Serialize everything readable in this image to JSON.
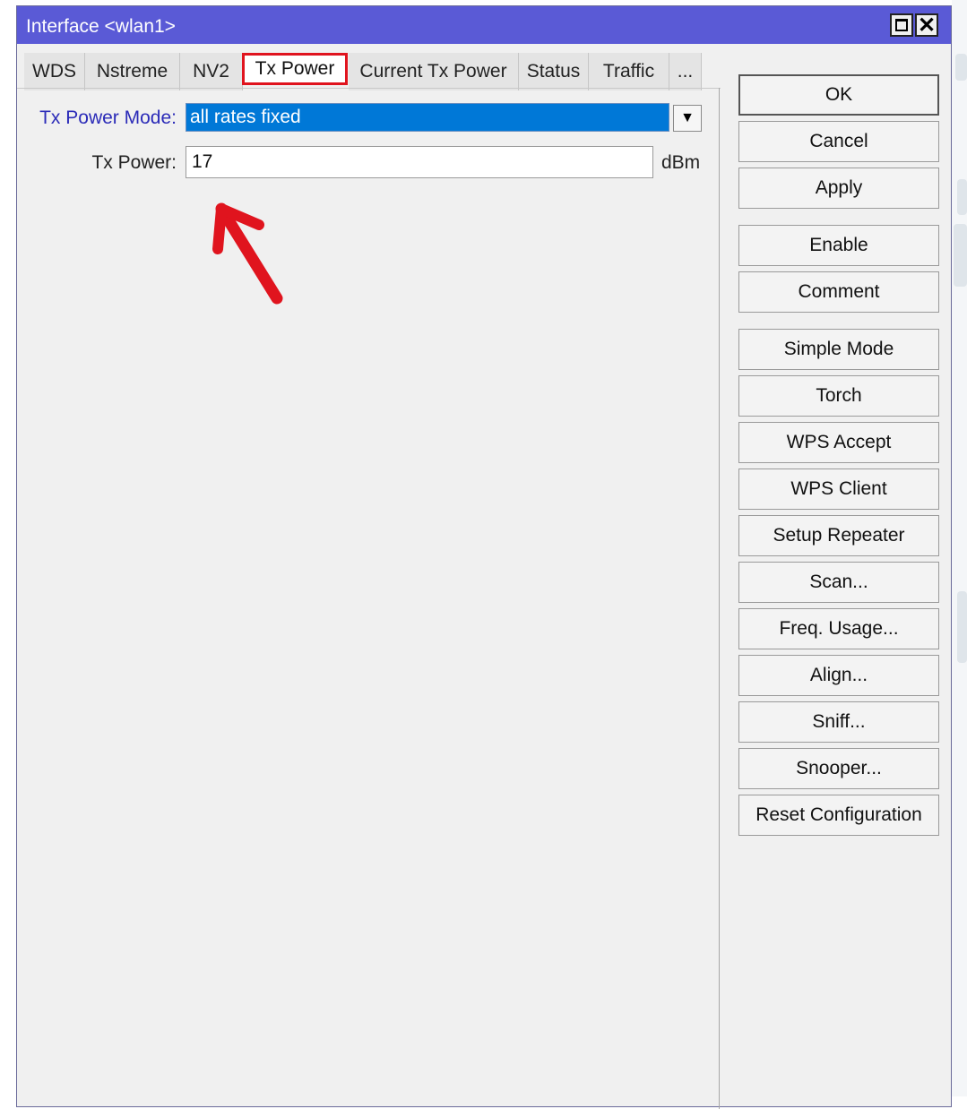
{
  "window": {
    "title": "Interface <wlan1>",
    "maximize_glyph": "",
    "close_glyph": "✕"
  },
  "tabs": [
    {
      "label": "WDS"
    },
    {
      "label": "Nstreme"
    },
    {
      "label": "NV2"
    },
    {
      "label": "Tx Power",
      "active": true
    },
    {
      "label": "Current Tx Power"
    },
    {
      "label": "Status"
    },
    {
      "label": "Traffic"
    },
    {
      "label": "..."
    }
  ],
  "form": {
    "tx_power_mode_label": "Tx Power Mode:",
    "tx_power_mode_value": "all rates fixed",
    "dropdown_glyph": "▼",
    "tx_power_label": "Tx Power:",
    "tx_power_value": "17",
    "tx_power_unit": "dBm"
  },
  "buttons": {
    "ok": "OK",
    "cancel": "Cancel",
    "apply": "Apply",
    "enable": "Enable",
    "comment": "Comment",
    "simple_mode": "Simple Mode",
    "torch": "Torch",
    "wps_accept": "WPS Accept",
    "wps_client": "WPS Client",
    "setup_repeater": "Setup Repeater",
    "scan": "Scan...",
    "freq_usage": "Freq. Usage...",
    "align": "Align...",
    "sniff": "Sniff...",
    "snooper": "Snooper...",
    "reset_configuration": "Reset Configuration"
  },
  "colors": {
    "titlebar": "#5a5ad6",
    "selection": "#0078d7",
    "highlight_annotation": "#e0141e",
    "label_accent": "#2b2bb8"
  }
}
